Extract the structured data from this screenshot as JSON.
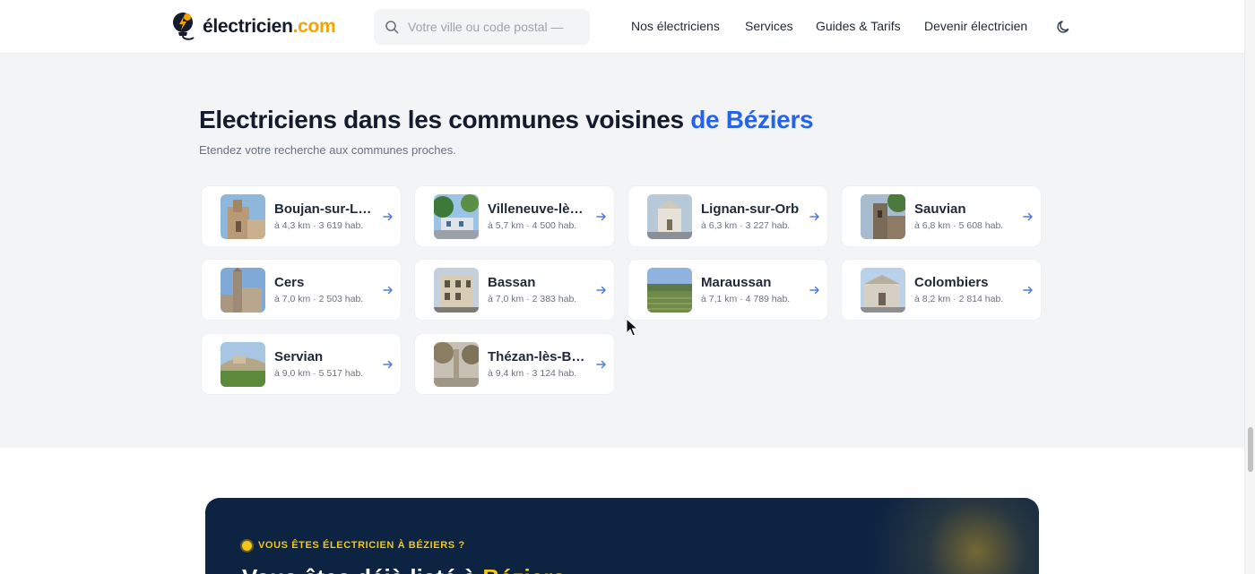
{
  "header": {
    "logo": {
      "base": "électricien",
      "tld": ".com"
    },
    "search": {
      "placeholder": "Votre ville ou code postal —"
    },
    "nav": [
      {
        "label": "Nos électriciens"
      },
      {
        "label": "Services"
      },
      {
        "label": "Guides & Tarifs"
      },
      {
        "label": "Devenir électricien"
      }
    ]
  },
  "section": {
    "title_main": "Electriciens dans les communes voisines ",
    "title_accent": "de Béziers",
    "subtitle": "Etendez votre recherche aux communes proches.",
    "cards": [
      {
        "name": "Boujan-sur-Libron",
        "meta": "à 4,3 km · 3 619 hab.",
        "icon": "church-photo"
      },
      {
        "name": "Villeneuve-lès-Béziers",
        "meta": "à 5,7 km · 4 500 hab.",
        "icon": "village-photo"
      },
      {
        "name": "Lignan-sur-Orb",
        "meta": "à 6,3 km · 3 227 hab.",
        "icon": "chapel-photo"
      },
      {
        "name": "Sauvian",
        "meta": "à 6,8 km · 5 608 hab.",
        "icon": "tower-photo"
      },
      {
        "name": "Cers",
        "meta": "à 7,0 km · 2 503 hab.",
        "icon": "church-photo"
      },
      {
        "name": "Bassan",
        "meta": "à 7,0 km · 2 383 hab.",
        "icon": "building-photo"
      },
      {
        "name": "Maraussan",
        "meta": "à 7,1 km · 4 789 hab.",
        "icon": "vineyard-photo"
      },
      {
        "name": "Colombiers",
        "meta": "à 8,2 km · 2 814 hab.",
        "icon": "chapel-photo"
      },
      {
        "name": "Servian",
        "meta": "à 9,0 km · 5 517 hab.",
        "icon": "hill-photo"
      },
      {
        "name": "Thézan-lès-Béziers",
        "meta": "à 9,4 km · 3 124 hab.",
        "icon": "square-photo"
      }
    ]
  },
  "cta": {
    "eyebrow": "VOUS ÊTES ÉLECTRICIEN À BÉZIERS ?",
    "heading_main": "Vous êtes déjà listé à ",
    "heading_highlight": "Béziers"
  },
  "colors": {
    "accent_blue": "#2563eb",
    "brand_orange": "#f4a300",
    "cta_bg": "#0c2342",
    "cta_yellow": "#f5c518"
  }
}
